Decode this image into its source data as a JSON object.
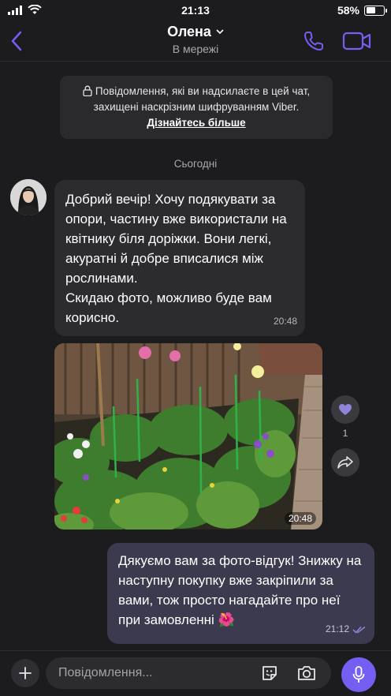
{
  "status_bar": {
    "time": "21:13",
    "battery": "58%",
    "battery_level": 0.58
  },
  "header": {
    "contact_name": "Олена",
    "contact_status": "В мережі"
  },
  "encryption_notice": {
    "text": "Повідомлення, які ви надсилаєте в цей чат, захищені наскрізним шифруванням Viber.",
    "link": "Дізнайтесь більше"
  },
  "date_separator": "Сьогодні",
  "messages": [
    {
      "direction": "incoming",
      "text": "Добрий вечір! Хочу подякувати за опори, частину вже використали на квітнику біля доріжки. Вони легкі, акуратні й добре вписалися між рослинами.\nСкидаю фото, можливо буде вам корисно.",
      "time": "20:48"
    },
    {
      "direction": "incoming",
      "type": "photo",
      "time": "20:48",
      "likes": "1"
    },
    {
      "direction": "outgoing",
      "text": "Дякуємо вам за фото-відгук! Знижку на наступну покупку вже закріпили за вами, тож просто нагадайте про неї при замовленні 🌺",
      "time": "21:12",
      "status": "read"
    }
  ],
  "input": {
    "placeholder": "Повідомлення..."
  },
  "colors": {
    "accent": "#7360f2",
    "background": "#1c1c1e",
    "incoming_bubble": "#2c2c2f",
    "outgoing_bubble": "#3c3a4e"
  },
  "icons": [
    "signal-icon",
    "wifi-icon",
    "battery-icon",
    "back-arrow-icon",
    "chevron-down-icon",
    "phone-icon",
    "video-camera-icon",
    "lock-icon",
    "heart-icon",
    "share-icon",
    "double-check-icon",
    "plus-icon",
    "sticker-icon",
    "camera-icon",
    "microphone-icon"
  ]
}
